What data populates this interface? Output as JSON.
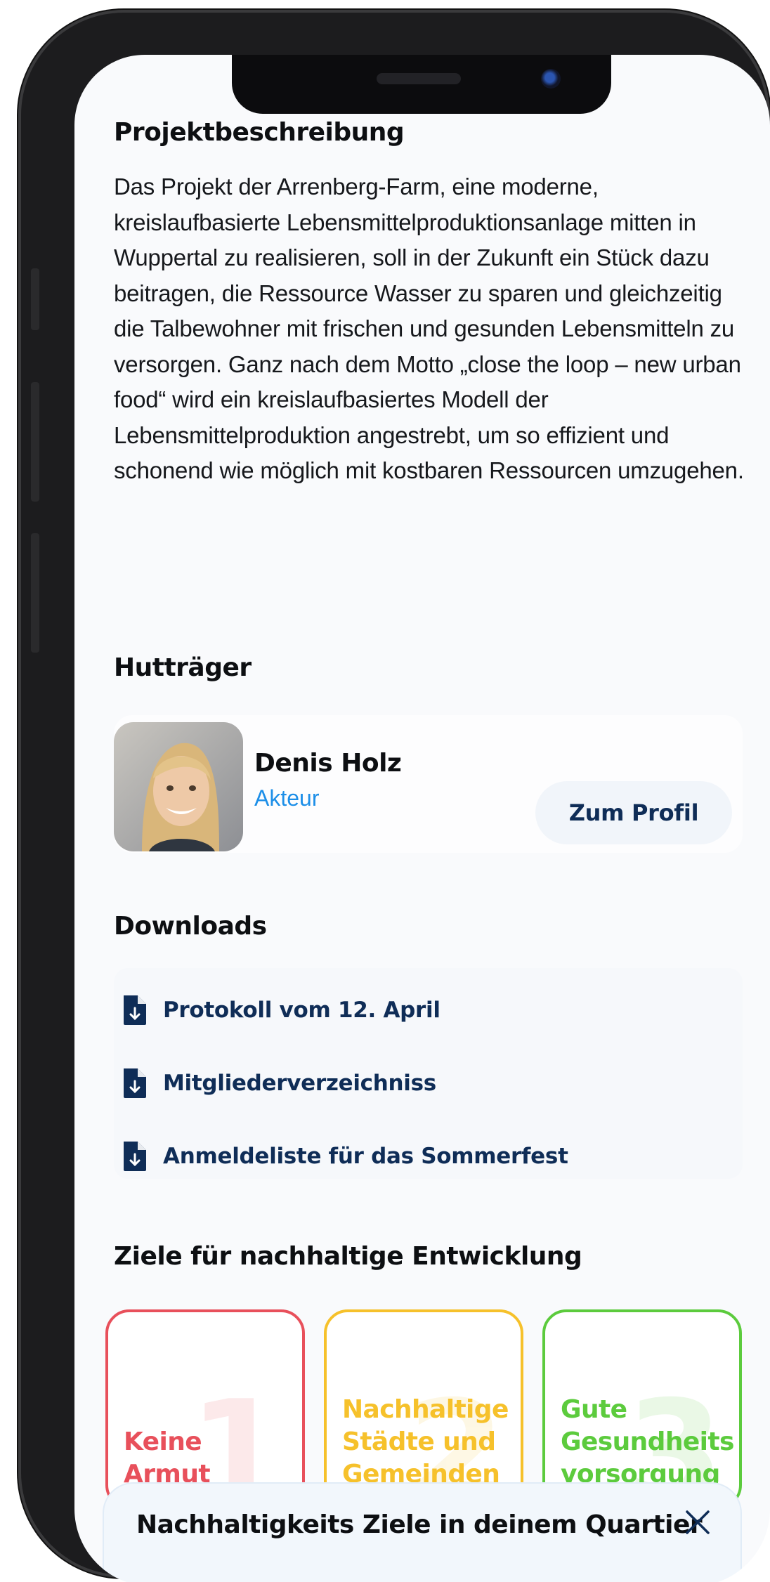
{
  "description": {
    "heading": "Projektbeschreibung",
    "text": "Das Projekt der Arrenberg-Farm, eine moderne, kreislaufbasierte Lebensmittelproduktionsanlage mitten in Wuppertal zu realisieren, soll in der Zukunft ein Stück dazu beitragen, die Ressource Wasser zu sparen und gleichzeitig die Talbewohner mit frischen und gesunden Lebensmitteln zu versorgen. Ganz nach dem Motto „close the loop – new urban food“ wird ein kreislaufbasiertes Modell der Lebensmittelproduktion angestrebt, um so effizient und schonend wie möglich mit kostbaren Ressourcen umzugehen."
  },
  "holder": {
    "heading": "Hutträger",
    "name": "Denis Holz",
    "role": "Akteur",
    "profile_button": "Zum Profil"
  },
  "downloads": {
    "heading": "Downloads",
    "items": [
      {
        "label": "Protokoll vom 12. April",
        "icon": "file-download-icon"
      },
      {
        "label": "Mitgliederverzeichniss",
        "icon": "file-download-icon"
      },
      {
        "label": "Anmeldeliste für das Sommerfest",
        "icon": "file-download-icon"
      }
    ]
  },
  "sdgs": {
    "heading": "Ziele für nachhaltige Entwicklung",
    "items": [
      {
        "number": "1",
        "line1": "Keine",
        "line2": "Armut",
        "line3": "",
        "color": "#e8505b"
      },
      {
        "number": "2",
        "line1": "Nachhaltige",
        "line2": "Städte und",
        "line3": "Gemeinden",
        "color": "#f6c12b"
      },
      {
        "number": "3",
        "line1": "Gute",
        "line2": "Gesundheits",
        "line3": "vorsorgung",
        "color": "#5ccb3d"
      }
    ]
  },
  "bottom_sheet": {
    "title": "Nachhaltigkeits Ziele in deinem Quartier",
    "close_icon": "close-icon"
  },
  "colors": {
    "link": "#1d8fe8",
    "navy": "#0f2d57"
  }
}
